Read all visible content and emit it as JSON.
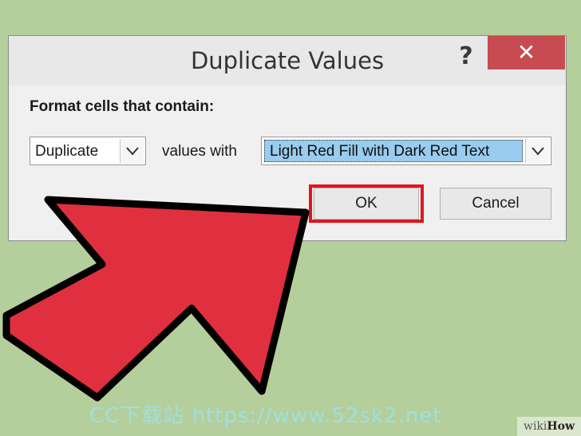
{
  "dialog": {
    "title": "Duplicate Values",
    "help_label": "?",
    "close_label": "✕",
    "section_label": "Format cells that contain:",
    "type_select": {
      "value": "Duplicate"
    },
    "values_with_label": "values with",
    "format_select": {
      "value": "Light Red Fill with Dark Red Text"
    },
    "ok_label": "OK",
    "cancel_label": "Cancel"
  },
  "watermark": {
    "text": "CC下载站 https://www.52sk2.net"
  },
  "brand": {
    "wiki": "wiki",
    "how": "How"
  },
  "colors": {
    "background": "#b4cf9c",
    "close_button": "#c74b50",
    "highlight": "#e2141e",
    "arrow": "#e03040",
    "selection": "#99ccee"
  },
  "icons": {
    "help": "question-mark-icon",
    "close": "close-icon",
    "dropdown": "chevron-down-icon",
    "pointer": "arrow-pointer-icon"
  }
}
